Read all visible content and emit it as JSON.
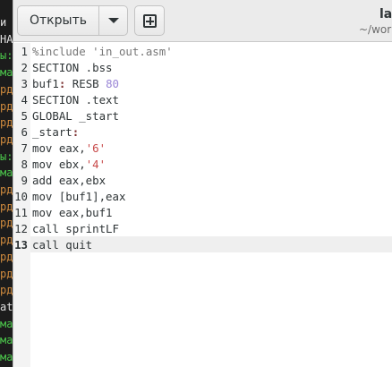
{
  "app": {
    "open_label": "Открыть",
    "title": "lab",
    "subtitle": "~/work"
  },
  "terminal_fragments": [
    "и",
    "HA",
    "ы:",
    "ма",
    "рд",
    "рд",
    "рд",
    "рд",
    "ы:",
    "ма",
    "рд",
    "рд",
    "рд",
    "рд",
    "рд",
    "рд",
    "рд",
    "at",
    "ма",
    "ма",
    "ма"
  ],
  "editor": {
    "current_line": 13,
    "lines": [
      {
        "n": "1",
        "tokens": [
          {
            "t": "%include 'in_out.asm'",
            "c": "pre"
          }
        ]
      },
      {
        "n": "2",
        "tokens": [
          {
            "t": "SECTION .bss",
            "c": ""
          }
        ]
      },
      {
        "n": "3",
        "tokens": [
          {
            "t": "buf1",
            "c": ""
          },
          {
            "t": ":",
            "c": "kw"
          },
          {
            "t": " RESB ",
            "c": ""
          },
          {
            "t": "80",
            "c": "num"
          }
        ]
      },
      {
        "n": "4",
        "tokens": [
          {
            "t": "SECTION .text",
            "c": ""
          }
        ]
      },
      {
        "n": "5",
        "tokens": [
          {
            "t": "GLOBAL _start",
            "c": ""
          }
        ]
      },
      {
        "n": "6",
        "tokens": [
          {
            "t": "_start",
            "c": ""
          },
          {
            "t": ":",
            "c": "kw"
          }
        ]
      },
      {
        "n": "7",
        "tokens": [
          {
            "t": "mov eax,",
            "c": ""
          },
          {
            "t": "'6'",
            "c": "str"
          }
        ]
      },
      {
        "n": "8",
        "tokens": [
          {
            "t": "mov ebx,",
            "c": ""
          },
          {
            "t": "'4'",
            "c": "str"
          }
        ]
      },
      {
        "n": "9",
        "tokens": [
          {
            "t": "add eax,ebx",
            "c": ""
          }
        ]
      },
      {
        "n": "10",
        "tokens": [
          {
            "t": "mov [buf1],eax",
            "c": ""
          }
        ]
      },
      {
        "n": "11",
        "tokens": [
          {
            "t": "mov eax,buf1",
            "c": ""
          }
        ]
      },
      {
        "n": "12",
        "tokens": [
          {
            "t": "call sprintLF",
            "c": ""
          }
        ]
      },
      {
        "n": "13",
        "tokens": [
          {
            "t": "call quit",
            "c": ""
          }
        ]
      }
    ]
  },
  "colors": {
    "terminal_green": "#4cc94c",
    "terminal_orange": "#d08b3e",
    "terminal_white": "#e0e0e0"
  }
}
